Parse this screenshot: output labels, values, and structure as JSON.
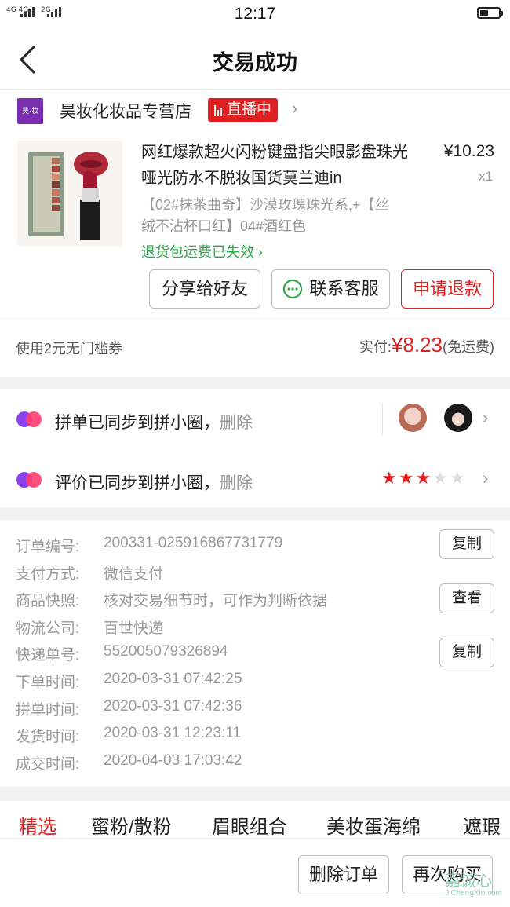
{
  "status_bar": {
    "signal1": "4G 4G",
    "signal2": "2G",
    "time": "12:17"
  },
  "nav": {
    "title": "交易成功"
  },
  "store": {
    "logo_text": "昊·妆",
    "name": "昊妆化妆品专营店",
    "live_badge": "直播中"
  },
  "product": {
    "title": "网红爆款超火闪粉键盘指尖眼影盘珠光哑光防水不脱妆国货莫兰迪in",
    "price": "¥10.23",
    "quantity": "x1",
    "variant": "【02#抹茶曲奇】沙漠玫瑰珠光系,+【丝绒不沾杯口红】04#酒红色",
    "refund_note": "退货包运费已失效"
  },
  "actions": {
    "share": "分享给好友",
    "service": "联系客服",
    "refund": "申请退款"
  },
  "payment": {
    "coupon": "使用2元无门槛券",
    "paid_label": "实付:",
    "paid_amount": "¥8.23",
    "paid_note": "(免运费)"
  },
  "sync": {
    "order_text": "拼单已同步到拼小圈，",
    "review_text": "评价已同步到拼小圈，",
    "delete": "删除",
    "rating": 3,
    "rating_max": 5
  },
  "order_info": {
    "rows": [
      {
        "label": "订单编号:",
        "value": "200331-025916867731779",
        "button": "复制"
      },
      {
        "label": "支付方式:",
        "value": "微信支付"
      },
      {
        "label": "商品快照:",
        "value": "核对交易细节时，可作为判断依据",
        "button": "查看"
      },
      {
        "label": "物流公司:",
        "value": "百世快递"
      },
      {
        "label": "快递单号:",
        "value": "552005079326894",
        "button": "复制"
      },
      {
        "label": "下单时间:",
        "value": "2020-03-31 07:42:25"
      },
      {
        "label": "拼单时间:",
        "value": "2020-03-31 07:42:36"
      },
      {
        "label": "发货时间:",
        "value": "2020-03-31 12:23:11"
      },
      {
        "label": "成交时间:",
        "value": "2020-04-03 17:03:42"
      }
    ]
  },
  "tabs": [
    "精选",
    "蜜粉/散粉",
    "眉眼组合",
    "美妆蛋海绵",
    "遮瑕"
  ],
  "bottom": {
    "delete_order": "删除订单",
    "buy_again": "再次购买"
  },
  "watermark": {
    "text": "嘉诚心",
    "url": "JiChengXin.com"
  },
  "colors": {
    "accent_red": "#e02020",
    "green": "#2ea84a",
    "store_purple": "#7b2fb0"
  }
}
